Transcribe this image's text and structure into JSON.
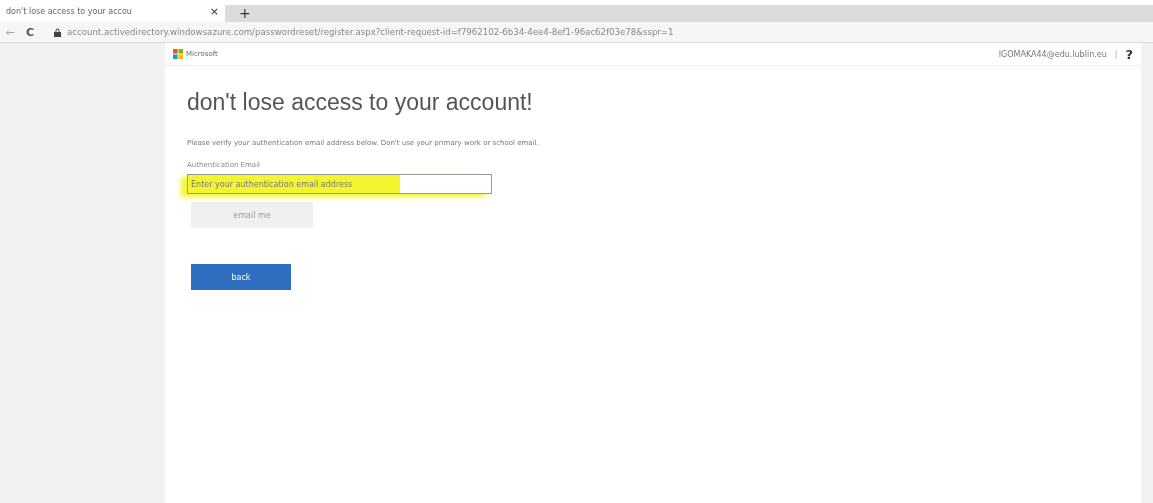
{
  "browser": {
    "tab": {
      "title": "don't lose access to your accou",
      "close": "×"
    },
    "new_tab": "+",
    "back": "←",
    "reload": "C",
    "url": "account.activedirectory.windowsazure.com/passwordreset/register.aspx?client-request-id=f7962102-6b34-4ee4-8ef1-96ac62f03e78&sspr=1"
  },
  "header": {
    "brand": "Microsoft",
    "user": "IGOMAKA44@edu.lublin.eu",
    "separator": "|",
    "help": "?"
  },
  "title": "don't lose access to your account!",
  "description": "Please verify your authentication email address below. Don't use your primary work or school email.",
  "field": {
    "label": "Authentication Email",
    "placeholder": "Enter your authentication email address",
    "highlighted": true
  },
  "buttons": [
    {
      "label": "email me",
      "kind": "secondary",
      "disabled": true
    },
    {
      "label": "back",
      "kind": "primary",
      "disabled": false
    }
  ]
}
